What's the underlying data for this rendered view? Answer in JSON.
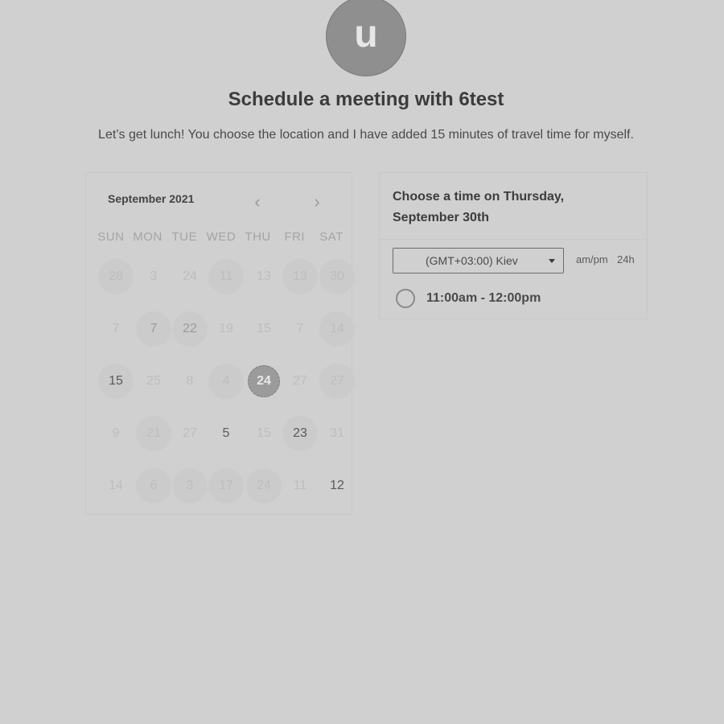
{
  "host": {
    "avatar_letter": "u",
    "title": "Schedule a meeting with 6test",
    "description": "Let’s get lunch! You choose the location and I have added 15 minutes of travel time for myself."
  },
  "calendar": {
    "month_label": "September 2021",
    "prev_icon": "chevron-left-icon",
    "next_icon": "chevron-right-icon",
    "weekdays": [
      "SUN",
      "MON",
      "TUE",
      "WED",
      "THU",
      "FRI",
      "SAT"
    ],
    "weeks": [
      [
        "28",
        "3",
        "24",
        "11",
        "13",
        "13",
        "30"
      ],
      [
        "7",
        "7",
        "22",
        "19",
        "15",
        "7",
        "14"
      ],
      [
        "15",
        "25",
        "8",
        "4",
        "24",
        "27",
        "27"
      ],
      [
        "9",
        "21",
        "27",
        "5",
        "15",
        "23",
        "31"
      ],
      [
        "14",
        "6",
        "3",
        "17",
        "24",
        "11",
        "12"
      ]
    ],
    "selected_day": "24"
  },
  "time_panel": {
    "heading": "Choose a time on Thursday, September 30th",
    "timezone_value": "(GMT+03:00) Kiev",
    "format_ampm": "am/pm",
    "format_24h": "24h",
    "slots": [
      {
        "label": "11:00am - 12:00pm"
      }
    ]
  }
}
